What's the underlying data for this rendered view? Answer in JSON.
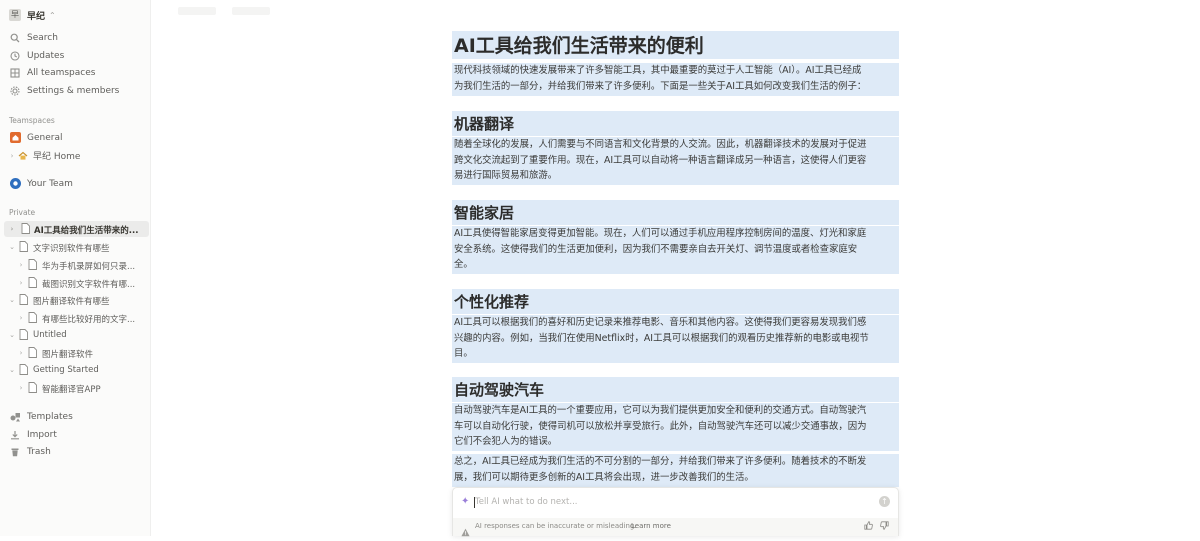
{
  "workspace": {
    "avatar": "早",
    "name": "早纪"
  },
  "nav": [
    {
      "label": "Search",
      "icon": "search-icon"
    },
    {
      "label": "Updates",
      "icon": "clock-icon"
    },
    {
      "label": "All teamspaces",
      "icon": "grid-icon"
    },
    {
      "label": "Settings & members",
      "icon": "gear-icon"
    }
  ],
  "teamspaces": {
    "heading": "Teamspaces",
    "items": [
      {
        "label": "General",
        "icon": "home-icon"
      },
      {
        "label": "早纪 Home",
        "icon": "house-emoji-icon"
      },
      {
        "label": "Your Team",
        "icon": "team-icon"
      }
    ]
  },
  "private": {
    "heading": "Private",
    "items": [
      {
        "label": "AI工具给我们生活带来的...",
        "selected": true
      },
      {
        "label": "文字识别软件有哪些"
      },
      {
        "label": "华为手机录屏如何只录..."
      },
      {
        "label": "截图识别文字软件有哪..."
      },
      {
        "label": "图片翻译软件有哪些"
      },
      {
        "label": "有哪些比较好用的文字..."
      },
      {
        "label": "Untitled"
      },
      {
        "label": "图片翻译软件"
      },
      {
        "label": "Getting Started"
      },
      {
        "label": "智能翻译官APP"
      }
    ]
  },
  "bottom_nav": [
    {
      "label": "Templates",
      "icon": "templates-icon"
    },
    {
      "label": "Import",
      "icon": "import-icon"
    },
    {
      "label": "Trash",
      "icon": "trash-icon"
    }
  ],
  "document": {
    "title": "AI工具给我们生活带来的便利",
    "intro_1": "现代科技领域的快速发展带来了许多智能工具，其中最重要的莫过于人工智能（AI）。AI工具已经成",
    "intro_2": "为我们生活的一部分，并给我们带来了许多便利。下面是一些关于AI工具如何改变我们生活的例子：",
    "sections": [
      {
        "heading": "机器翻译",
        "lines": [
          "随着全球化的发展，人们需要与不同语言和文化背景的人交流。因此，机器翻译技术的发展对于促进",
          "跨文化交流起到了重要作用。现在，AI工具可以自动将一种语言翻译成另一种语言，这使得人们更容",
          "易进行国际贸易和旅游。"
        ]
      },
      {
        "heading": "智能家居",
        "lines": [
          "AI工具使得智能家居变得更加智能。现在，人们可以通过手机应用程序控制房间的温度、灯光和家庭",
          "安全系统。这使得我们的生活更加便利，因为我们不需要亲自去开关灯、调节温度或者检查家庭安",
          "全。"
        ]
      },
      {
        "heading": "个性化推荐",
        "lines": [
          "AI工具可以根据我们的喜好和历史记录来推荐电影、音乐和其他内容。这使得我们更容易发现我们感",
          "兴趣的内容。例如，当我们在使用Netflix时，AI工具可以根据我们的观看历史推荐新的电影或电视节",
          "目。"
        ]
      },
      {
        "heading": "自动驾驶汽车",
        "lines": [
          "自动驾驶汽车是AI工具的一个重要应用，它可以为我们提供更加安全和便利的交通方式。自动驾驶汽",
          "车可以自动化行驶，使得司机可以放松并享受旅行。此外，自动驾驶汽车还可以减少交通事故，因为",
          "它们不会犯人为的错误。"
        ]
      }
    ],
    "conclusion_1": "总之，AI工具已经成为我们生活的不可分割的一部分，并给我们带来了许多便利。随着技术的不断发",
    "conclusion_2": "展，我们可以期待更多创新的AI工具将会出现，进一步改善我们的生活。"
  },
  "ai_bar": {
    "placeholder": "Tell AI what to do next...",
    "disclaimer": "AI responses can be inaccurate or misleading.",
    "learn_more": "Learn more"
  },
  "colors": {
    "highlight": "#deeaf7",
    "sidebar_bg": "#fbfbfa",
    "home_icon": "#e16b2e",
    "team_icon": "#2f6fbf"
  }
}
